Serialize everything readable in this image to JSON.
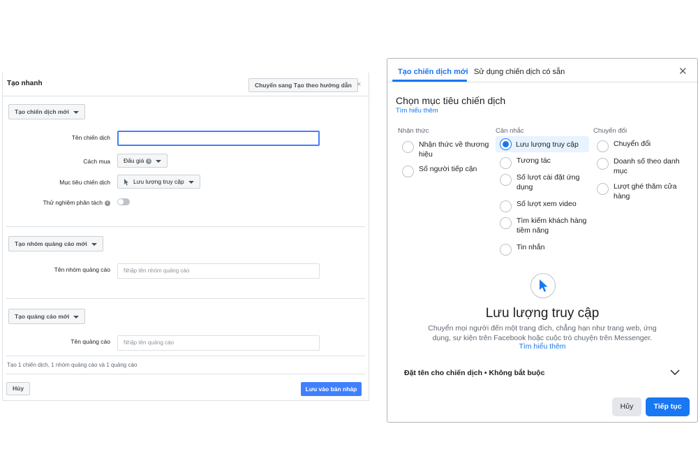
{
  "quick_create": {
    "title": "Tạo nhanh",
    "guided_button": "Chuyển sang Tạo theo hướng dẫn",
    "close": "×",
    "campaign_dropdown": "Tạo chiến dịch mới",
    "campaign_name_label": "Tên chiến dịch",
    "campaign_name_value": "",
    "buying_type_label": "Cách mua",
    "buying_type_value": "Đấu giá",
    "objective_label": "Mục tiêu chiến dịch",
    "objective_value": "Lưu lượng truy cập",
    "split_test_label": "Thử nghiệm phân tách",
    "split_test_on": false,
    "adset_dropdown": "Tạo nhóm quảng cáo mới",
    "adset_name_label": "Tên nhóm quảng cáo",
    "adset_name_placeholder": "Nhập tên nhóm quảng cáo",
    "ad_dropdown": "Tạo quảng cáo mới",
    "ad_name_label": "Tên quảng cáo",
    "ad_name_placeholder": "Nhập tên quảng cáo",
    "summary": "Tạo 1 chiến dịch, 1 nhóm quảng cáo và 1 quảng cáo",
    "cancel_label": "Hủy",
    "save_draft_label": "Lưu vào bản nháp"
  },
  "objective_dialog": {
    "tabs": [
      {
        "label": "Tạo chiến dịch mới",
        "active": true
      },
      {
        "label": "Sử dụng chiến dịch có sẵn",
        "active": false
      }
    ],
    "close": "✕",
    "heading": "Chọn mục tiêu chiến dịch",
    "learn_more": "Tìm hiểu thêm",
    "columns": [
      {
        "header": "Nhận thức",
        "options": [
          {
            "line1": "Nhận thức về thương",
            "line2": "hiệu",
            "selected": false
          },
          {
            "line1": "Số người tiếp cận",
            "line2": "",
            "selected": false
          }
        ]
      },
      {
        "header": "Cân nhắc",
        "options": [
          {
            "line1": "Lưu lượng truy cập",
            "line2": "",
            "selected": true
          },
          {
            "line1": "Tương tác",
            "line2": "",
            "selected": false
          },
          {
            "line1": "Số lượt cài đặt ứng",
            "line2": "dụng",
            "selected": false
          },
          {
            "line1": "Số lượt xem video",
            "line2": "",
            "selected": false
          },
          {
            "line1": "Tìm kiếm khách hàng",
            "line2": "tiềm năng",
            "selected": false
          },
          {
            "line1": "Tin nhắn",
            "line2": "",
            "selected": false
          }
        ]
      },
      {
        "header": "Chuyển đổi",
        "options": [
          {
            "line1": "Chuyển đổi",
            "line2": "",
            "selected": false
          },
          {
            "line1": "Doanh số theo danh",
            "line2": "mục",
            "selected": false
          },
          {
            "line1": "Lượt ghé thăm cửa",
            "line2": "hàng",
            "selected": false
          }
        ]
      }
    ],
    "detail": {
      "icon": "cursor-icon",
      "title": "Lưu lượng truy cập",
      "description_line1": "Chuyển mọi người đến một trang đích, chẳng hạn như trang web, ứng",
      "description_line2": "dụng, sự kiện trên Facebook hoặc cuộc trò chuyện trên Messenger.",
      "learn_more": "Tìm hiểu thêm"
    },
    "name_campaign_label": "Đặt tên cho chiến dịch • Không bắt buộc",
    "cancel_label": "Hủy",
    "continue_label": "Tiếp tục",
    "colors": {
      "primary": "#1877f2",
      "selected_bg": "#e7f3ff"
    }
  }
}
